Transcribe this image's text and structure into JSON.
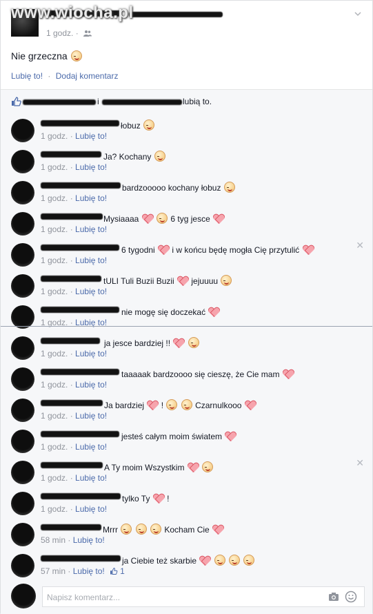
{
  "watermark": "www.wiocha.pl",
  "post": {
    "time": "1 godz.",
    "separator": "·",
    "text": "Nie grzeczna",
    "like_label": "Lubię to!",
    "comment_label": "Dodaj komentarz"
  },
  "likes_bar": {
    "connector": "i",
    "suffix": "lubią to."
  },
  "comment_like_label": "Lubię to!",
  "comments": [
    {
      "text": "łobuz",
      "time": "1 godz."
    },
    {
      "text": "Ja? Kochany",
      "time": "1 godz."
    },
    {
      "text": "bardzooooo kochany łobuz",
      "time": "1 godz."
    },
    {
      "text": "Mysiaaaa",
      "text2": "6 tyg jesce",
      "time": "1 godz."
    },
    {
      "text": "6 tygodni",
      "text2": "i w końcu będę mogła Cię przytulić",
      "time": "1 godz."
    },
    {
      "text": "tULI Tuli Buzii Buzii",
      "text2": "jejuuuu",
      "time": "1 godz."
    },
    {
      "text": "nie mogę się doczekać",
      "time": "1 godz."
    },
    {
      "text": "ja jesce bardziej !!",
      "time": "1 godz."
    },
    {
      "text": "taaaaak bardzoooo się cieszę, że Cie mam",
      "time": "1 godz."
    },
    {
      "text": "Ja bardziej",
      "text2": "!",
      "text3": "Czarnulkooo",
      "time": "1 godz."
    },
    {
      "text": "jesteś całym moim światem",
      "time": "1 godz."
    },
    {
      "text": "A Ty moim Wszystkim",
      "time": "1 godz."
    },
    {
      "text": "tylko Ty",
      "text2": "!",
      "time": "1 godz."
    },
    {
      "text": "Mrrr",
      "text2": "Kocham Cie",
      "time": "58 min"
    },
    {
      "text": "ja Ciebie też skarbie",
      "time": "57 min",
      "likes": "1"
    }
  ],
  "composer": {
    "placeholder": "Napisz komentarz..."
  },
  "colors": {
    "link": "#4b6aaa",
    "meta": "#90949c",
    "background": "#f6f7f9"
  }
}
